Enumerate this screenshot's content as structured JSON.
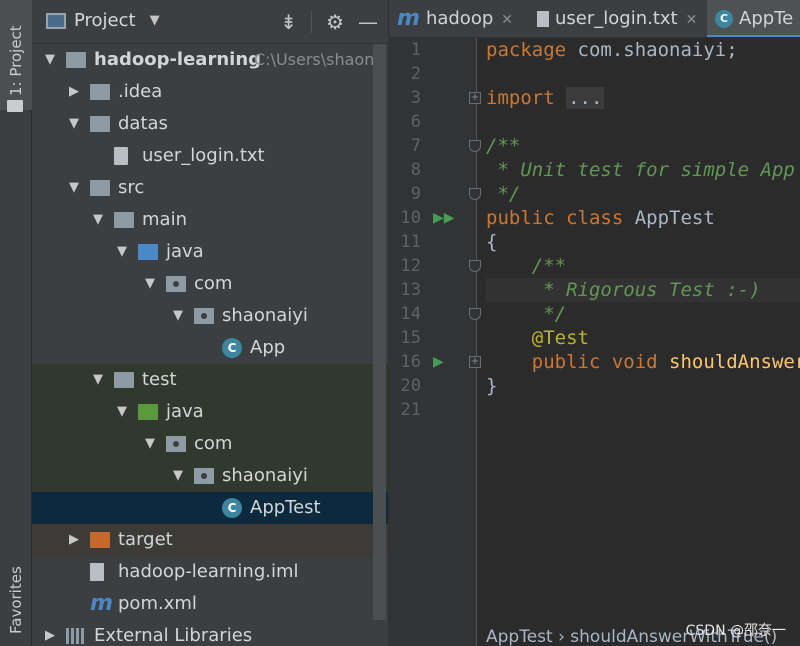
{
  "side_strip": {
    "project_tab": "1: Project",
    "favorites_tab": "Favorites"
  },
  "panel": {
    "title": "Project"
  },
  "tree": [
    {
      "label": "hadoop-learning",
      "hint": "C:\\Users\\shaona",
      "icon": "project-module-icon",
      "twisty": "down"
    },
    {
      "label": ".idea",
      "icon": "folder-icon",
      "twisty": "right"
    },
    {
      "label": "datas",
      "icon": "folder-icon",
      "twisty": "down"
    },
    {
      "label": "user_login.txt",
      "icon": "text-file-icon",
      "twisty": ""
    },
    {
      "label": "src",
      "icon": "folder-icon",
      "twisty": "down"
    },
    {
      "label": "main",
      "icon": "folder-icon",
      "twisty": "down"
    },
    {
      "label": "java",
      "icon": "source-folder-icon",
      "twisty": "down"
    },
    {
      "label": "com",
      "icon": "package-icon",
      "twisty": "down"
    },
    {
      "label": "shaonaiyi",
      "icon": "package-icon",
      "twisty": "down"
    },
    {
      "label": "App",
      "icon": "java-class-icon",
      "twisty": ""
    },
    {
      "label": "test",
      "icon": "folder-icon",
      "twisty": "down"
    },
    {
      "label": "java",
      "icon": "test-folder-icon",
      "twisty": "down"
    },
    {
      "label": "com",
      "icon": "package-icon",
      "twisty": "down"
    },
    {
      "label": "shaonaiyi",
      "icon": "package-icon",
      "twisty": "down"
    },
    {
      "label": "AppTest",
      "icon": "java-class-icon",
      "twisty": ""
    },
    {
      "label": "target",
      "icon": "excluded-folder-icon",
      "twisty": "right"
    },
    {
      "label": "hadoop-learning.iml",
      "icon": "iml-file-icon",
      "twisty": ""
    },
    {
      "label": "pom.xml",
      "icon": "maven-icon",
      "twisty": ""
    },
    {
      "label": "External Libraries",
      "icon": "libraries-icon",
      "twisty": "right"
    }
  ],
  "tabs": [
    {
      "label": "hadoop",
      "icon": "maven-icon"
    },
    {
      "label": "user_login.txt",
      "icon": "text-file-icon"
    },
    {
      "label": "AppTe",
      "icon": "java-class-icon"
    }
  ],
  "gutter_lines": [
    "1",
    "2",
    "3",
    "6",
    "7",
    "8",
    "9",
    "10",
    "11",
    "12",
    "13",
    "14",
    "15",
    "16",
    "20",
    "21"
  ],
  "code": {
    "l1_kw": "package",
    "l1_rest": " com.shaonaiyi;",
    "l3_kw": "import",
    "l3_fold": "...",
    "l7": "/**",
    "l8": " * Unit test for simple App",
    "l9": " */",
    "l10_kw": "public class",
    "l10_rest": " AppTest",
    "l11": "{",
    "l12": "    /**",
    "l13": "     * Rigorous Test :-)",
    "l14": "     */",
    "l15": "    @Test",
    "l16_kw": "    public void",
    "l16_fn": " shouldAnswerWithTrue()",
    "l20": "}"
  },
  "breadcrumb": "AppTest  ›  shouldAnswerWithTrue()",
  "watermark": "CSDN @邵奈一"
}
